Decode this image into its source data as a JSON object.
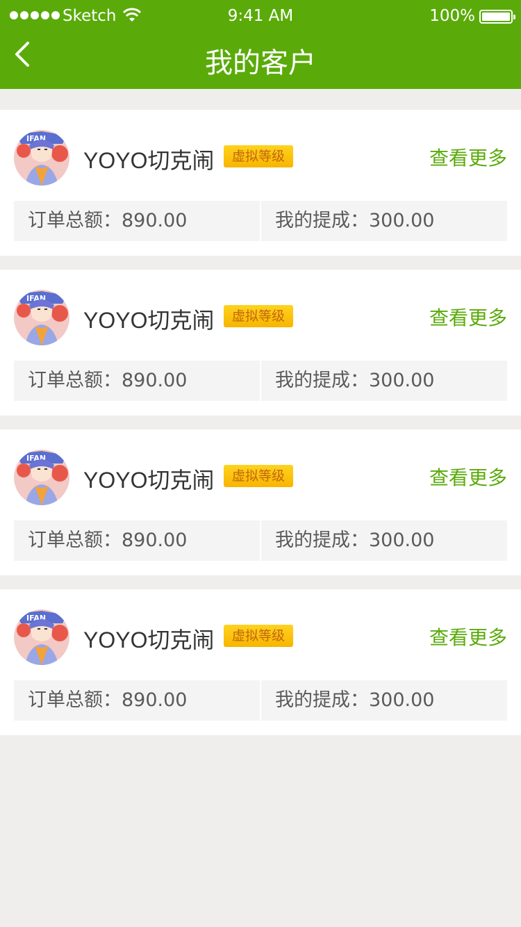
{
  "status_bar": {
    "carrier": "Sketch",
    "time": "9:41 AM",
    "battery_percent": "100%",
    "signal_icon": "signal-dots-icon",
    "wifi_icon": "wifi-icon",
    "battery_icon": "battery-icon",
    "battery_level": 1.0
  },
  "header": {
    "title": "我的客户",
    "back_icon": "chevron-left-icon",
    "background_color": "#5aab0a"
  },
  "colors": {
    "accent": "#5aab0a",
    "badge": "#f7b500",
    "page_bg": "#efeeec"
  },
  "customers": [
    {
      "avatar_icon": "avatar-image",
      "name": "YOYO切克闹",
      "level_badge": "虚拟等级",
      "view_more": "查看更多",
      "order_total": "订单总额：890.00",
      "commission": "我的提成：300.00"
    },
    {
      "avatar_icon": "avatar-image",
      "name": "YOYO切克闹",
      "level_badge": "虚拟等级",
      "view_more": "查看更多",
      "order_total": "订单总额：890.00",
      "commission": "我的提成：300.00"
    },
    {
      "avatar_icon": "avatar-image",
      "name": "YOYO切克闹",
      "level_badge": "虚拟等级",
      "view_more": "查看更多",
      "order_total": "订单总额：890.00",
      "commission": "我的提成：300.00"
    },
    {
      "avatar_icon": "avatar-image",
      "name": "YOYO切克闹",
      "level_badge": "虚拟等级",
      "view_more": "查看更多",
      "order_total": "订单总额：890.00",
      "commission": "我的提成：300.00"
    }
  ]
}
